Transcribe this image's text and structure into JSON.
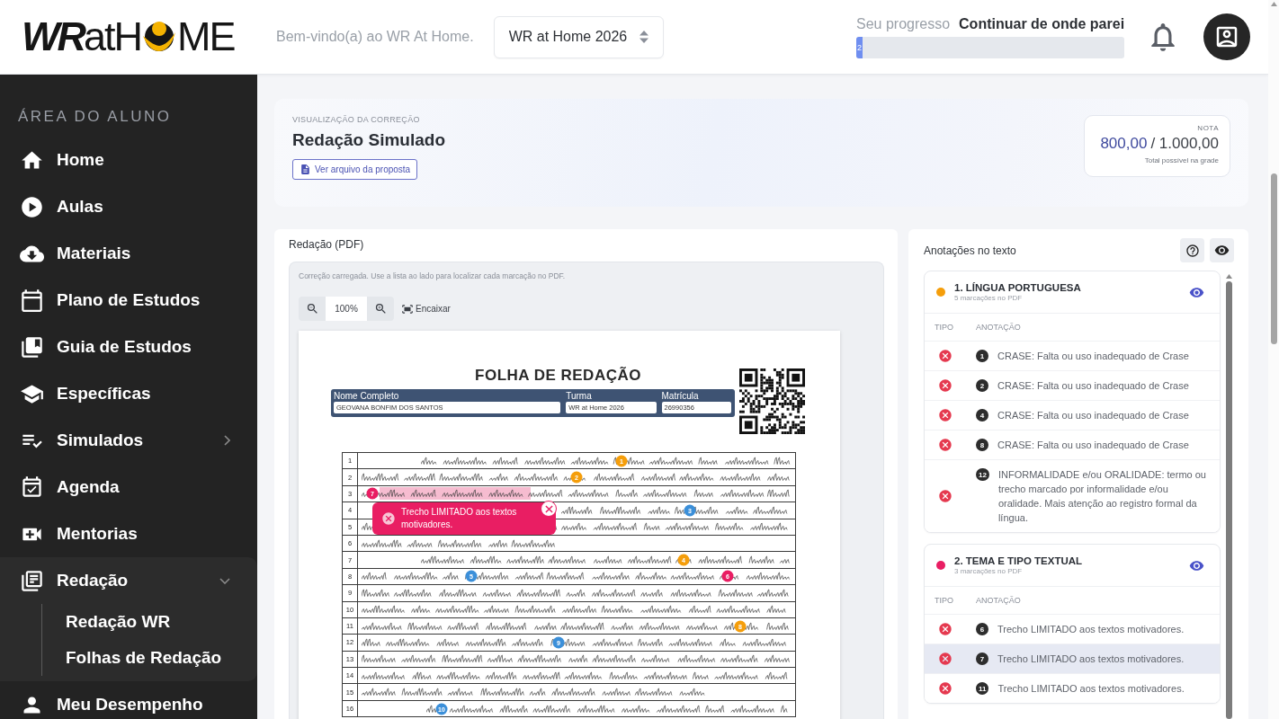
{
  "header": {
    "logo": {
      "lead": "**WR**atH",
      "tail": "ME"
    },
    "welcome": "Bem-vindo(a) ao WR At Home.",
    "course_select": {
      "value": "WR at Home 2026"
    },
    "progress": {
      "label": "Seu progresso",
      "link": "Continuar de onde parei",
      "level": 0.025,
      "reading": "2"
    }
  },
  "sidebar": {
    "title": "ÁREA DO ALUNO",
    "items": [
      {
        "label": "Home"
      },
      {
        "label": "Aulas"
      },
      {
        "label": "Materiais"
      },
      {
        "label": "Plano de Estudos"
      },
      {
        "label": "Guia de Estudos"
      },
      {
        "label": "Específicas"
      },
      {
        "label": "Simulados",
        "expanded": false
      },
      {
        "label": "Agenda"
      },
      {
        "label": "Mentorias"
      },
      {
        "label": "Redação",
        "expanded": true,
        "children": [
          {
            "label": "Redação WR"
          },
          {
            "label": "Folhas de Redação"
          }
        ]
      },
      {
        "label": "Meu Desempenho"
      }
    ]
  },
  "correction_card": {
    "eyebrow": "VISUALIZAÇÃO DA CORREÇÃO",
    "title": "Redação Simulado",
    "proposal_button": "Ver arquivo da proposta",
    "grade": {
      "label": "NOTA",
      "score": "800,00",
      "total": "/ 1.000,00",
      "caption": "Total possível na grade"
    }
  },
  "pdf_panel": {
    "title": "Redação (PDF)",
    "status": "Correção carregada. Use a lista ao lado para localizar cada marcação no PDF.",
    "zoom": {
      "value": "100%",
      "fit_button": "Encaixar"
    },
    "sheet": {
      "title": "FOLHA DE REDAÇÃO",
      "fields": [
        {
          "label": "Nome Completo",
          "value": "GEOVANA BONFIM DOS SANTOS"
        },
        {
          "label": "Turma",
          "value": "WR at Home 2026"
        },
        {
          "label": "Matrícula",
          "value": "26990356"
        }
      ],
      "line_numbers": [
        "1",
        "2",
        "3",
        "4",
        "5",
        "6",
        "7",
        "8",
        "9",
        "10",
        "11",
        "12",
        "13",
        "14",
        "15",
        "16"
      ],
      "markers": [
        {
          "label": "1",
          "color": "#f59e0b"
        },
        {
          "label": "2",
          "color": "#f59e0b"
        },
        {
          "label": "3",
          "color": "#3b8fd9"
        },
        {
          "label": "4",
          "color": "#f59e0b"
        },
        {
          "label": "5",
          "color": "#3b8fd9"
        },
        {
          "label": "6",
          "color": "#e91e63"
        },
        {
          "label": "7",
          "color": "#e91e63"
        },
        {
          "label": "8",
          "color": "#f59e0b"
        },
        {
          "label": "9",
          "color": "#3b8fd9"
        },
        {
          "label": "10",
          "color": "#3b8fd9"
        }
      ],
      "popup": {
        "text": "Trecho LIMITADO aos textos motivadores."
      }
    }
  },
  "annotations_panel": {
    "title": "Anotações no texto",
    "categories": [
      {
        "title": "1. LÍNGUA PORTUGUESA",
        "subtitle": "5 marcações no PDF",
        "color": "#f59e0b",
        "visible": true,
        "columns": [
          "TIPO",
          "ANOTAÇÃO"
        ],
        "rows": [
          {
            "kind": "error",
            "number": "1",
            "text": "CRASE: Falta ou uso inadequado de Crase",
            "selected": false
          },
          {
            "kind": "error",
            "number": "2",
            "text": "CRASE: Falta ou uso inadequado de Crase",
            "selected": false
          },
          {
            "kind": "error",
            "number": "4",
            "text": "CRASE: Falta ou uso inadequado de Crase",
            "selected": false
          },
          {
            "kind": "error",
            "number": "8",
            "text": "CRASE: Falta ou uso inadequado de Crase",
            "selected": false
          },
          {
            "kind": "error",
            "number": "12",
            "text": "INFORMALIDADE e/ou ORALIDADE: termo ou trecho marcado por informalidade e/ou oralidade. Mais atenção ao registro formal da língua.",
            "selected": false
          }
        ]
      },
      {
        "title": "2. TEMA E TIPO TEXTUAL",
        "subtitle": "3 marcações no PDF",
        "color": "#e91e63",
        "visible": true,
        "columns": [
          "TIPO",
          "ANOTAÇÃO"
        ],
        "rows": [
          {
            "kind": "error",
            "number": "6",
            "text": "Trecho LIMITADO aos textos motivadores.",
            "selected": false
          },
          {
            "kind": "error",
            "number": "7",
            "text": "Trecho LIMITADO aos textos motivadores.",
            "selected": true
          },
          {
            "kind": "error",
            "number": "11",
            "text": "Trecho LIMITADO aos textos motivadores.",
            "selected": false
          }
        ]
      }
    ]
  }
}
